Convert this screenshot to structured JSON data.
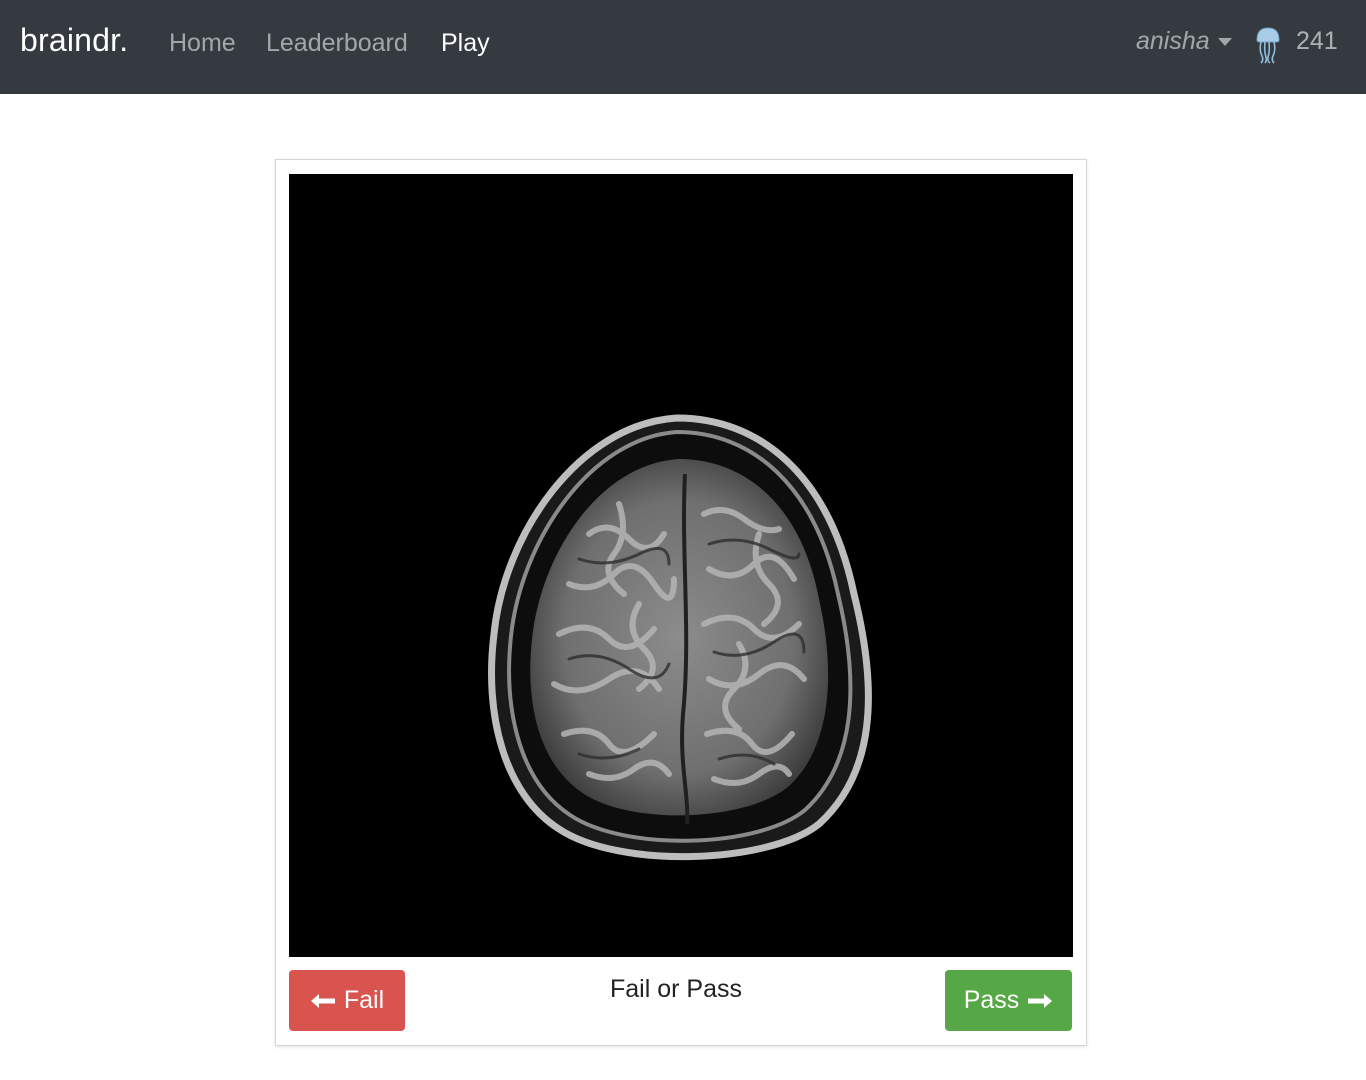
{
  "navbar": {
    "brand": "braindr.",
    "links": [
      {
        "label": "Home",
        "active": false
      },
      {
        "label": "Leaderboard",
        "active": false
      },
      {
        "label": "Play",
        "active": true
      }
    ],
    "user": "anisha",
    "avatar_icon": "jellyfish-icon",
    "score": "241",
    "background": "#343a40"
  },
  "game": {
    "prompt": "Fail or Pass",
    "fail_label": "Fail",
    "pass_label": "Pass",
    "fail_icon": "arrow-left-icon",
    "pass_icon": "arrow-right-icon",
    "fail_color": "#d9534f",
    "pass_color": "#56a846"
  }
}
